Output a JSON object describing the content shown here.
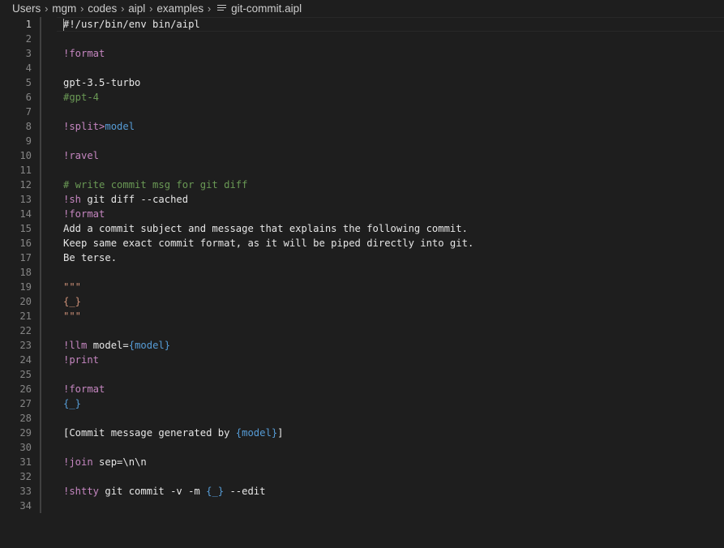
{
  "breadcrumb": {
    "items": [
      "Users",
      "mgm",
      "codes",
      "aipl",
      "examples"
    ],
    "file_name": "git-commit.aipl",
    "file_icon": "text-file-icon"
  },
  "editor": {
    "active_line": 1,
    "lines": [
      {
        "n": "1",
        "tokens": [
          {
            "t": "#!/usr/bin/env bin/aipl",
            "c": "plain"
          }
        ]
      },
      {
        "n": "2",
        "tokens": []
      },
      {
        "n": "3",
        "tokens": [
          {
            "t": "!format",
            "c": "kw"
          }
        ]
      },
      {
        "n": "4",
        "tokens": []
      },
      {
        "n": "5",
        "tokens": [
          {
            "t": "gpt-3.5-turbo",
            "c": "plain"
          }
        ]
      },
      {
        "n": "6",
        "tokens": [
          {
            "t": "#gpt-4",
            "c": "green"
          }
        ]
      },
      {
        "n": "7",
        "tokens": []
      },
      {
        "n": "8",
        "tokens": [
          {
            "t": "!split>",
            "c": "kw"
          },
          {
            "t": "model",
            "c": "blue"
          }
        ]
      },
      {
        "n": "9",
        "tokens": []
      },
      {
        "n": "10",
        "tokens": [
          {
            "t": "!ravel",
            "c": "kw"
          }
        ]
      },
      {
        "n": "11",
        "tokens": []
      },
      {
        "n": "12",
        "tokens": [
          {
            "t": "# write commit msg for git diff",
            "c": "green"
          }
        ]
      },
      {
        "n": "13",
        "tokens": [
          {
            "t": "!sh",
            "c": "kw"
          },
          {
            "t": " git diff --cached",
            "c": "plain"
          }
        ]
      },
      {
        "n": "14",
        "tokens": [
          {
            "t": "!format",
            "c": "kw"
          }
        ]
      },
      {
        "n": "15",
        "tokens": [
          {
            "t": "Add a commit subject and message that explains the following commit.",
            "c": "plain"
          }
        ]
      },
      {
        "n": "16",
        "tokens": [
          {
            "t": "Keep same exact commit format, as it will be piped directly into git.",
            "c": "plain"
          }
        ]
      },
      {
        "n": "17",
        "tokens": [
          {
            "t": "Be terse.",
            "c": "plain"
          }
        ]
      },
      {
        "n": "18",
        "tokens": []
      },
      {
        "n": "19",
        "tokens": [
          {
            "t": "\"\"\"",
            "c": "orange"
          }
        ]
      },
      {
        "n": "20",
        "tokens": [
          {
            "t": "{_}",
            "c": "orange"
          }
        ]
      },
      {
        "n": "21",
        "tokens": [
          {
            "t": "\"\"\"",
            "c": "orange"
          }
        ]
      },
      {
        "n": "22",
        "tokens": []
      },
      {
        "n": "23",
        "tokens": [
          {
            "t": "!llm",
            "c": "kw"
          },
          {
            "t": " model=",
            "c": "plain"
          },
          {
            "t": "{model}",
            "c": "blue"
          }
        ]
      },
      {
        "n": "24",
        "tokens": [
          {
            "t": "!print",
            "c": "kw"
          }
        ]
      },
      {
        "n": "25",
        "tokens": []
      },
      {
        "n": "26",
        "tokens": [
          {
            "t": "!format",
            "c": "kw"
          }
        ]
      },
      {
        "n": "27",
        "tokens": [
          {
            "t": "{_}",
            "c": "blue"
          }
        ]
      },
      {
        "n": "28",
        "tokens": []
      },
      {
        "n": "29",
        "tokens": [
          {
            "t": "[Commit message generated by ",
            "c": "plain"
          },
          {
            "t": "{model}",
            "c": "blue"
          },
          {
            "t": "]",
            "c": "plain"
          }
        ]
      },
      {
        "n": "30",
        "tokens": []
      },
      {
        "n": "31",
        "tokens": [
          {
            "t": "!join",
            "c": "kw"
          },
          {
            "t": " sep=\\n\\n",
            "c": "plain"
          }
        ]
      },
      {
        "n": "32",
        "tokens": []
      },
      {
        "n": "33",
        "tokens": [
          {
            "t": "!shtty",
            "c": "kw"
          },
          {
            "t": " git commit -v -m ",
            "c": "plain"
          },
          {
            "t": "{_}",
            "c": "blue"
          },
          {
            "t": " --edit",
            "c": "plain"
          }
        ]
      },
      {
        "n": "34",
        "tokens": []
      }
    ]
  },
  "colors": {
    "background": "#1e1e1e",
    "keyword": "#c586c0",
    "variable": "#569cd6",
    "comment": "#6a9955",
    "string": "#ce9178",
    "text": "#e6e6e6",
    "line_number": "#858585"
  }
}
